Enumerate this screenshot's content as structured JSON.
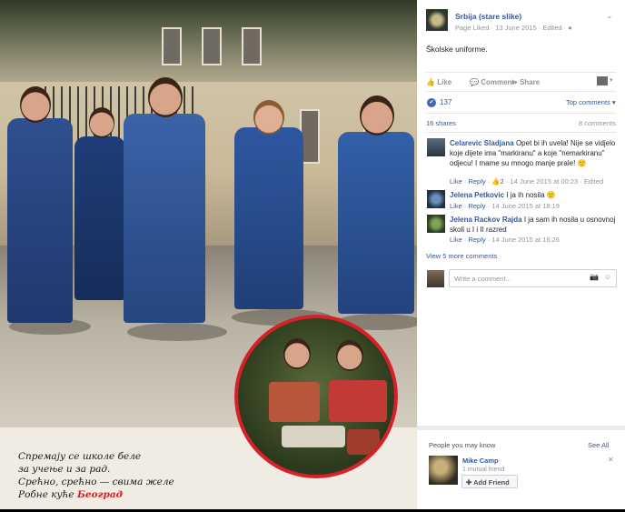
{
  "photo": {
    "ad_lines": [
      "Спремају се школе беле",
      "за учење и за рад.",
      "Срећно, срећно — свима желе",
      "Робне куће"
    ],
    "brand": "Београд"
  },
  "post": {
    "page_name": "Srbija (stare slike)",
    "meta": "Page Liked · 13 June 2015 · Edited · ",
    "caption": "Školske uniforme.",
    "actions": {
      "like": "Like",
      "comment": "Comment",
      "share": "Share"
    },
    "reactions_count": "137",
    "top_comments": "Top comments ▾",
    "shares": "16 shares",
    "comments_count": "8 comments"
  },
  "comments": [
    {
      "author": "Celarevic Sladjana",
      "text": "Opet bi ih uvela! Nije se vidjelo koje dijete ima \"markiranu\" a koje \"nemarkiranu\" odjecu! I mame su mnogo manje prale!",
      "like": "Like",
      "reply": "Reply",
      "likes": "2",
      "time": "14 June 2015 at 00:23",
      "edited": "Edited"
    },
    {
      "author": "Jelena Petkovic",
      "text": "I ja ih nosila",
      "like": "Like",
      "reply": "Reply",
      "time": "14 June 2015 at 18:19"
    },
    {
      "author": "Jelena Rackov Rajda",
      "text": "I ja sam ih nosila u osnovnoj skoli u I i II razred",
      "like": "Like",
      "reply": "Reply",
      "time": "14 June 2015 at 16:26"
    }
  ],
  "view_more": "View 5 more comments",
  "write_placeholder": "Write a comment...",
  "people": {
    "title": "People you may know",
    "see_all": "See All",
    "person_name": "Mike Camp",
    "mutual": "1 mutual friend",
    "add_friend": "Add Friend"
  },
  "colors": {
    "link": "#365899",
    "like_blue": "#4267b2",
    "ad_red": "#d8202a"
  }
}
